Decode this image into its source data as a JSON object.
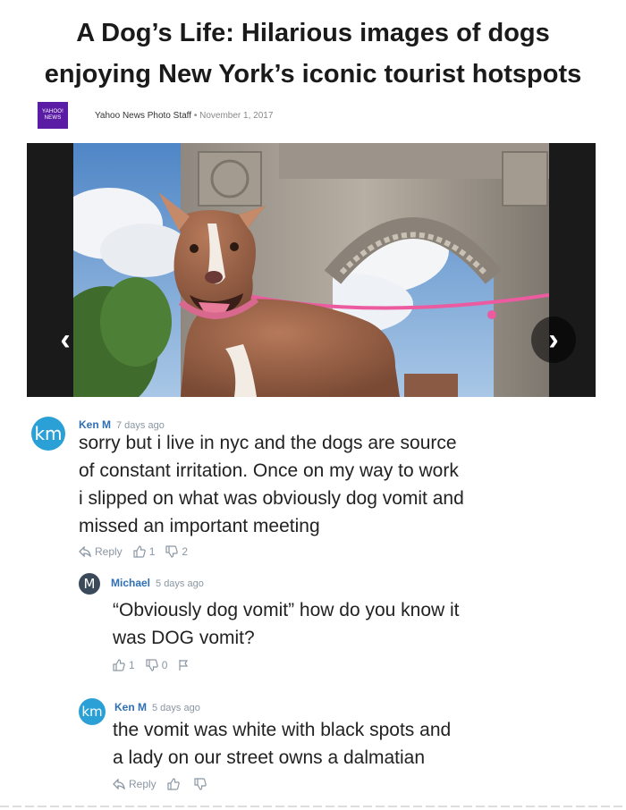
{
  "article": {
    "title_line1": "A Dog’s Life: Hilarious images of dogs",
    "title_line2": "enjoying New York’s iconic tourist hotspots",
    "logo_line1": "YAHOO!",
    "logo_line2": "NEWS",
    "author": "Yahoo News Photo Staff",
    "separator": "•",
    "date": "November 1, 2017"
  },
  "carousel": {
    "prev_icon": "chevron-left-icon",
    "next_icon": "chevron-right-icon",
    "prev_glyph": "‹",
    "next_glyph": "›"
  },
  "comments": [
    {
      "avatar": "km",
      "author": "Ken M",
      "time": "7 days ago",
      "lines": [
        "sorry but i live in nyc and the dogs are source",
        "of constant irritation. Once on my way to work",
        "i slipped on what was obviously dog vomit and",
        "missed an important meeting"
      ],
      "reply_label": "Reply",
      "upvotes": "1",
      "downvotes": "2"
    },
    {
      "avatar": "M",
      "author": "Michael",
      "time": "5 days ago",
      "lines": [
        "“Obviously dog vomit” how do you know it",
        "was DOG vomit?"
      ],
      "upvotes": "1",
      "downvotes": "0"
    },
    {
      "avatar": "km",
      "author": "Ken M",
      "time": "5 days ago",
      "lines": [
        "the vomit was white with black spots and",
        "a lady on our street owns a dalmatian"
      ],
      "reply_label": "Reply"
    }
  ],
  "colors": {
    "link_blue": "#2e6fb5",
    "avatar_km": "#2aa0d6",
    "logo_purple": "#5b1ca5"
  }
}
